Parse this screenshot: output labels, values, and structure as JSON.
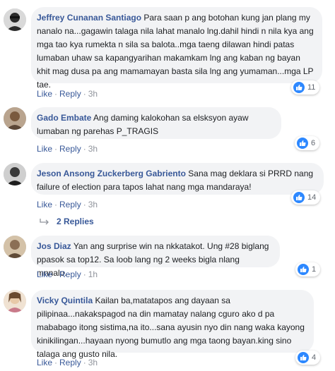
{
  "comments": [
    {
      "name": "Jeffrey Cunanan Santiago",
      "text": "Para saan p ang botohan kung jan plang my nanalo na...gagawin talaga nila lahat manalo lng.dahil hindi n nila kya ang mga tao kya rumekta n sila sa balota..mga taeng dilawan hindi patas lumaban uhaw sa kapangyarihan makamkam lng ang kaban ng bayan khit mag dusa pa ang mamamayan basta sila lng ang yumaman...mga LP tae.",
      "like": "Like",
      "reply": "Reply",
      "time": "3h",
      "reactions": "11",
      "avatar_color": "#2b2b2b"
    },
    {
      "name": "Gado Embate",
      "text": "Ang daming kalokohan sa elsksyon ayaw lumaban ng parehas P_TRAGIS",
      "like": "Like",
      "reply": "Reply",
      "time": "3h",
      "reactions": "6",
      "avatar_color": "#7a5a3e"
    },
    {
      "name": "Jeson Ansong Zuckerberg Gabriento",
      "text": "Sana mag deklara si PRRD nang failure of election para tapos lahat nang mga mandaraya!",
      "like": "Like",
      "reply": "Reply",
      "time": "3h",
      "reactions": "14",
      "avatar_color": "#3a3a3a"
    },
    {
      "name": "Jos Diaz",
      "text": "Yan ang surprise win na nkkatakot. Ung #28 biglang ppasok sa top12. Sa loob lang ng 2 weeks bigla nlang mnnalo.",
      "like": "Like",
      "reply": "Reply",
      "time": "1h",
      "reactions": "1",
      "avatar_color": "#8b6f55"
    },
    {
      "name": "Vicky Quintila",
      "text": "Kailan ba,matatapos ang dayaan sa pilipinaa...nakakspagod na din mamatay nalang cguro ako d pa mababago itong sistima,na ito...sana ayusin nyo din nang waka kayong kinikilingan...hayaan nyong bumutlo ang mga taong bayan.king sino talaga ang gusto nila.",
      "like": "Like",
      "reply": "Reply",
      "time": "3h",
      "reactions": "4",
      "avatar_color": "#e8c9a8"
    }
  ],
  "replies_label": "2 Replies",
  "colors": {
    "link": "#385898",
    "bubble": "#f2f3f5",
    "like_blue": "#2d88ff",
    "meta": "#90949c"
  }
}
